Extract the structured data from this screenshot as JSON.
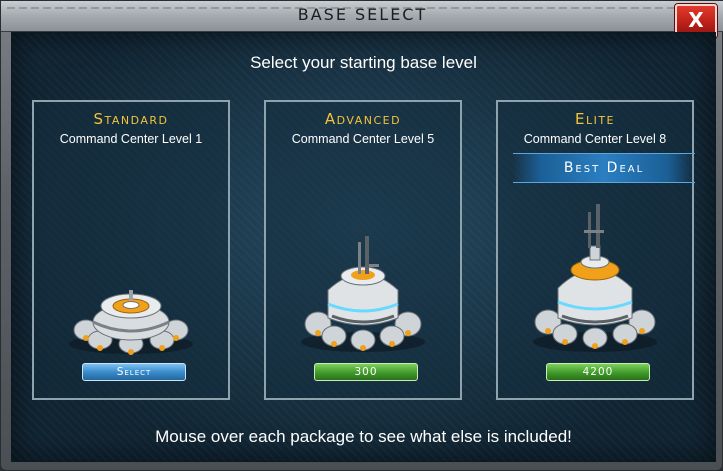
{
  "dialog": {
    "title": "BASE SELECT",
    "close_label": "X",
    "heading": "Select your starting base level",
    "footer": "Mouse over each package to see what else is included!"
  },
  "packages": [
    {
      "name": "Standard",
      "subtitle": "Command Center Level 1",
      "button_label": "Select",
      "button_color": "#3a8ccd"
    },
    {
      "name": "Advanced",
      "subtitle": "Command Center Level 5",
      "button_label": "300",
      "button_color": "#3f9a2a"
    },
    {
      "name": "Elite",
      "subtitle": "Command Center Level 8",
      "badge": "Best Deal",
      "button_label": "4200",
      "button_color": "#3f9a2a"
    }
  ],
  "colors": {
    "title_gold": "#f3c43a",
    "close_red": "#c92a20",
    "accent_orange": "#f0a019",
    "glow_cyan": "#6ad9ff"
  }
}
